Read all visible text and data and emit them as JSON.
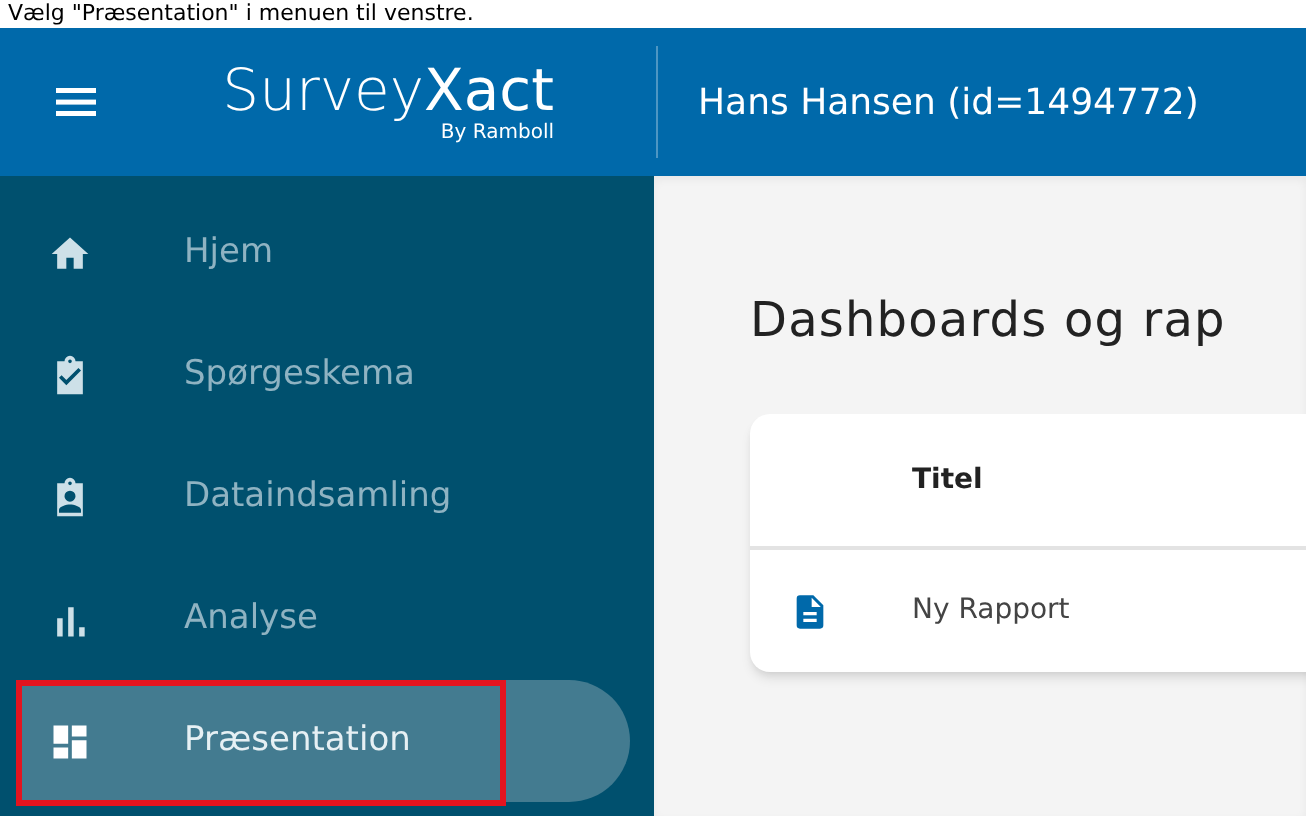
{
  "caption": "Vælg \"Præsentation\" i menuen til venstre.",
  "header": {
    "logo": "Survey**Xact**",
    "logo_sub": "By Ramboll",
    "user": "Hans Hansen (id=1494772)"
  },
  "sidebar": {
    "items": [
      {
        "label": "Hjem",
        "kind": "home",
        "selected": false,
        "highlighted": false
      },
      {
        "label": "Spørgeskema",
        "kind": "survey",
        "selected": false,
        "highlighted": false
      },
      {
        "label": "Dataindsamling",
        "kind": "collection",
        "selected": false,
        "highlighted": false
      },
      {
        "label": "Analyse",
        "kind": "analysis",
        "selected": false,
        "highlighted": false
      },
      {
        "label": "Præsentation",
        "kind": "presentation",
        "selected": true,
        "highlighted": true
      }
    ]
  },
  "main": {
    "title": "Dashboards og rap",
    "table": {
      "columns": [
        "Titel"
      ],
      "rows": [
        {
          "title": "Ny Rapport"
        }
      ]
    }
  }
}
